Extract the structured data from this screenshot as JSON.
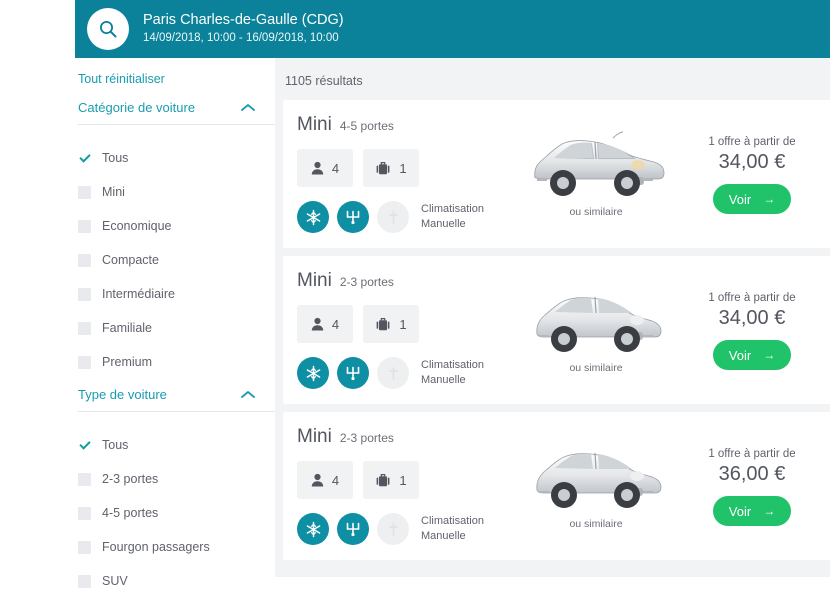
{
  "header": {
    "search_icon": "search-icon",
    "location": "Paris Charles-de-Gaulle (CDG)",
    "dates": "14/09/2018, 10:00 - 16/09/2018, 10:00",
    "bg_color": "#0b8299"
  },
  "sidebar": {
    "reset_label": "Tout réinitialiser",
    "groups": [
      {
        "title": "Catégorie de voiture",
        "collapse_icon": "chevron-up-icon",
        "options": [
          {
            "label": "Tous",
            "checked": true
          },
          {
            "label": "Mini",
            "checked": false
          },
          {
            "label": "Economique",
            "checked": false
          },
          {
            "label": "Compacte",
            "checked": false
          },
          {
            "label": "Intermédiaire",
            "checked": false
          },
          {
            "label": "Familiale",
            "checked": false
          },
          {
            "label": "Premium",
            "checked": false
          }
        ]
      },
      {
        "title": "Type de voiture",
        "collapse_icon": "chevron-up-icon",
        "options": [
          {
            "label": "Tous",
            "checked": true
          },
          {
            "label": "2-3 portes",
            "checked": false
          },
          {
            "label": "4-5 portes",
            "checked": false
          },
          {
            "label": "Fourgon passagers",
            "checked": false
          },
          {
            "label": "SUV",
            "checked": false
          }
        ]
      }
    ],
    "accent_color": "#1a9cb0"
  },
  "results": {
    "count_label": "1105 résultats",
    "similar_label": "ou similaire",
    "offer_label": "1 offre à partir de",
    "view_label": "Voir",
    "view_arrow": "→",
    "button_color": "#21c36a",
    "cards": [
      {
        "category": "Mini",
        "doors": "4-5 portes",
        "passengers": "4",
        "luggage": "1",
        "passenger_icon": "person-icon",
        "luggage_icon": "suitcase-icon",
        "badges": [
          {
            "icon": "snowflake-icon",
            "active": true
          },
          {
            "icon": "gearshift-icon",
            "active": true
          },
          {
            "icon": "fuel-icon",
            "active": false
          }
        ],
        "features": "Climatisation\nManuelle",
        "feature_line1": "Climatisation",
        "feature_line2": "Manuelle",
        "price": "34,00 €",
        "car_art": "silver-hatchback-5door"
      },
      {
        "category": "Mini",
        "doors": "2-3 portes",
        "passengers": "4",
        "luggage": "1",
        "passenger_icon": "person-icon",
        "luggage_icon": "suitcase-icon",
        "badges": [
          {
            "icon": "snowflake-icon",
            "active": true
          },
          {
            "icon": "gearshift-icon",
            "active": true
          },
          {
            "icon": "fuel-icon",
            "active": false
          }
        ],
        "feature_line1": "Climatisation",
        "feature_line2": "Manuelle",
        "price": "34,00 €",
        "car_art": "silver-citycar-3door"
      },
      {
        "category": "Mini",
        "doors": "2-3 portes",
        "passengers": "4",
        "luggage": "1",
        "passenger_icon": "person-icon",
        "luggage_icon": "suitcase-icon",
        "badges": [
          {
            "icon": "snowflake-icon",
            "active": true
          },
          {
            "icon": "gearshift-icon",
            "active": true
          },
          {
            "icon": "fuel-icon",
            "active": false
          }
        ],
        "feature_line1": "Climatisation",
        "feature_line2": "Manuelle",
        "price": "36,00 €",
        "car_art": "silver-citycar-3door"
      }
    ]
  }
}
